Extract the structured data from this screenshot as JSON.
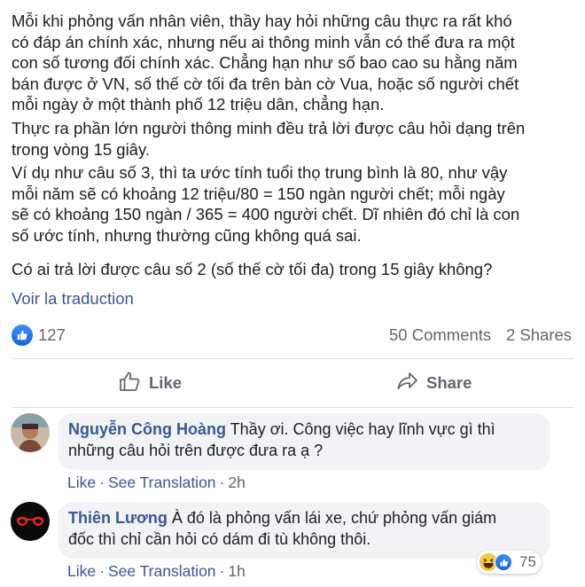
{
  "post": {
    "paragraphs": [
      {
        "lines": [
          "Mỗi khi phỏng vấn nhân viên, thầy hay hỏi những câu thực ra rất khó",
          "có đáp án chính xác, nhưng nếu ai thông minh vẫn có thể đưa ra một",
          "con số tương đối chính xác. Chẳng hạn như số bao cao su hằng năm",
          "bán được ở VN, số thế cờ tối đa trên bàn cờ Vua, hoặc số người chết",
          "mỗi ngày ở một thành phố 12 triệu dân, chẳng hạn."
        ]
      },
      {
        "lines": [
          "Thực ra phần lớn người thông minh đều trả lời được câu hỏi dạng trên",
          "trong vòng 15 giây."
        ]
      },
      {
        "lines": [
          "Ví dụ như câu số 3, thì ta ước tính tuổi thọ trung bình là 80, như vậy",
          "mỗi năm sẽ có khoảng 12 triệu/80 = 150 ngàn người chết; mỗi ngày",
          "sẽ có khoảng 150 ngàn / 365 = 400 người chết. Dĩ nhiên đó chỉ là con",
          "số ước tính, nhưng thường cũng không quá sai."
        ]
      },
      {
        "lines": [
          "Có ai trả lời được câu số 2 (số thế cờ tối đa) trong 15 giây không?"
        ]
      }
    ],
    "translate_label": "Voir la traduction"
  },
  "reactions": {
    "count": "127",
    "comments": "50 Comments",
    "shares": "2 Shares",
    "icon": "like-reaction-icon",
    "accent": "#1877f2"
  },
  "actions": {
    "like_label": "Like",
    "share_label": "Share"
  },
  "comments": [
    {
      "author": "Nguyễn Công Hoàng",
      "text_line1": " Thầy ơi. Công việc hay lĩnh vực gì thì",
      "text_line2": "những câu hỏi trên được đưa ra ạ ?",
      "like": "Like",
      "see_translation": "See Translation",
      "time": "2h",
      "dot": "·"
    },
    {
      "author": "Thiên Lương",
      "text_line1": " À đó là phỏng vấn lái xe, chứ phỏng vấn giám",
      "text_line2": "đốc thì chỉ cần hỏi có dám đi tù không thôi.",
      "like": "Like",
      "see_translation": "See Translation",
      "time": "1h",
      "dot": "·",
      "reaction_count": "75"
    }
  ],
  "colors": {
    "link": "#385898",
    "muted": "#606770",
    "bubble": "#f2f3f5",
    "divider": "#dadde1"
  }
}
